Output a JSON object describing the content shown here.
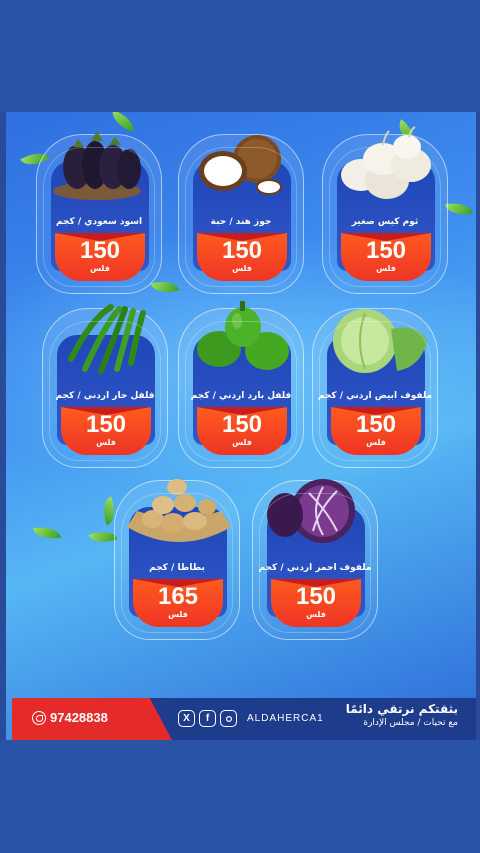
{
  "products": [
    {
      "name": "ثوم كيس صغير",
      "price": "150",
      "unit": "فلس",
      "image": "garlic"
    },
    {
      "name": "جوز هند / حبة",
      "price": "150",
      "unit": "فلس",
      "image": "coconut"
    },
    {
      "name": "اسود سعودي / كجم",
      "price": "150",
      "unit": "فلس",
      "image": "eggplant"
    },
    {
      "name": "ملفوف ابيض اردني / كجم",
      "price": "150",
      "unit": "فلس",
      "image": "cabbage"
    },
    {
      "name": "فلفل بارد اردني / كجم",
      "price": "150",
      "unit": "فلس",
      "image": "green-bell-pepper"
    },
    {
      "name": "فلفل حار اردني / كجم",
      "price": "150",
      "unit": "فلس",
      "image": "green-chili"
    },
    {
      "name": "ملفوف احمر اردني / كجم",
      "price": "150",
      "unit": "فلس",
      "image": "red-cabbage"
    },
    {
      "name": "بطاطا / كجم",
      "price": "165",
      "unit": "فلس",
      "image": "potato"
    }
  ],
  "footer": {
    "phone": "97428838",
    "handle": "ALDAHERCA1",
    "slogan": "بثقتكم نرتقي دائمًا",
    "signature": "مع تحيات / مجلس الإدارة",
    "social_icons": [
      "x-icon",
      "facebook-icon",
      "instagram-icon"
    ]
  },
  "colors": {
    "frame": "#2853a6",
    "price_red": "#ee3524",
    "card_blue": "#1f47b8"
  }
}
